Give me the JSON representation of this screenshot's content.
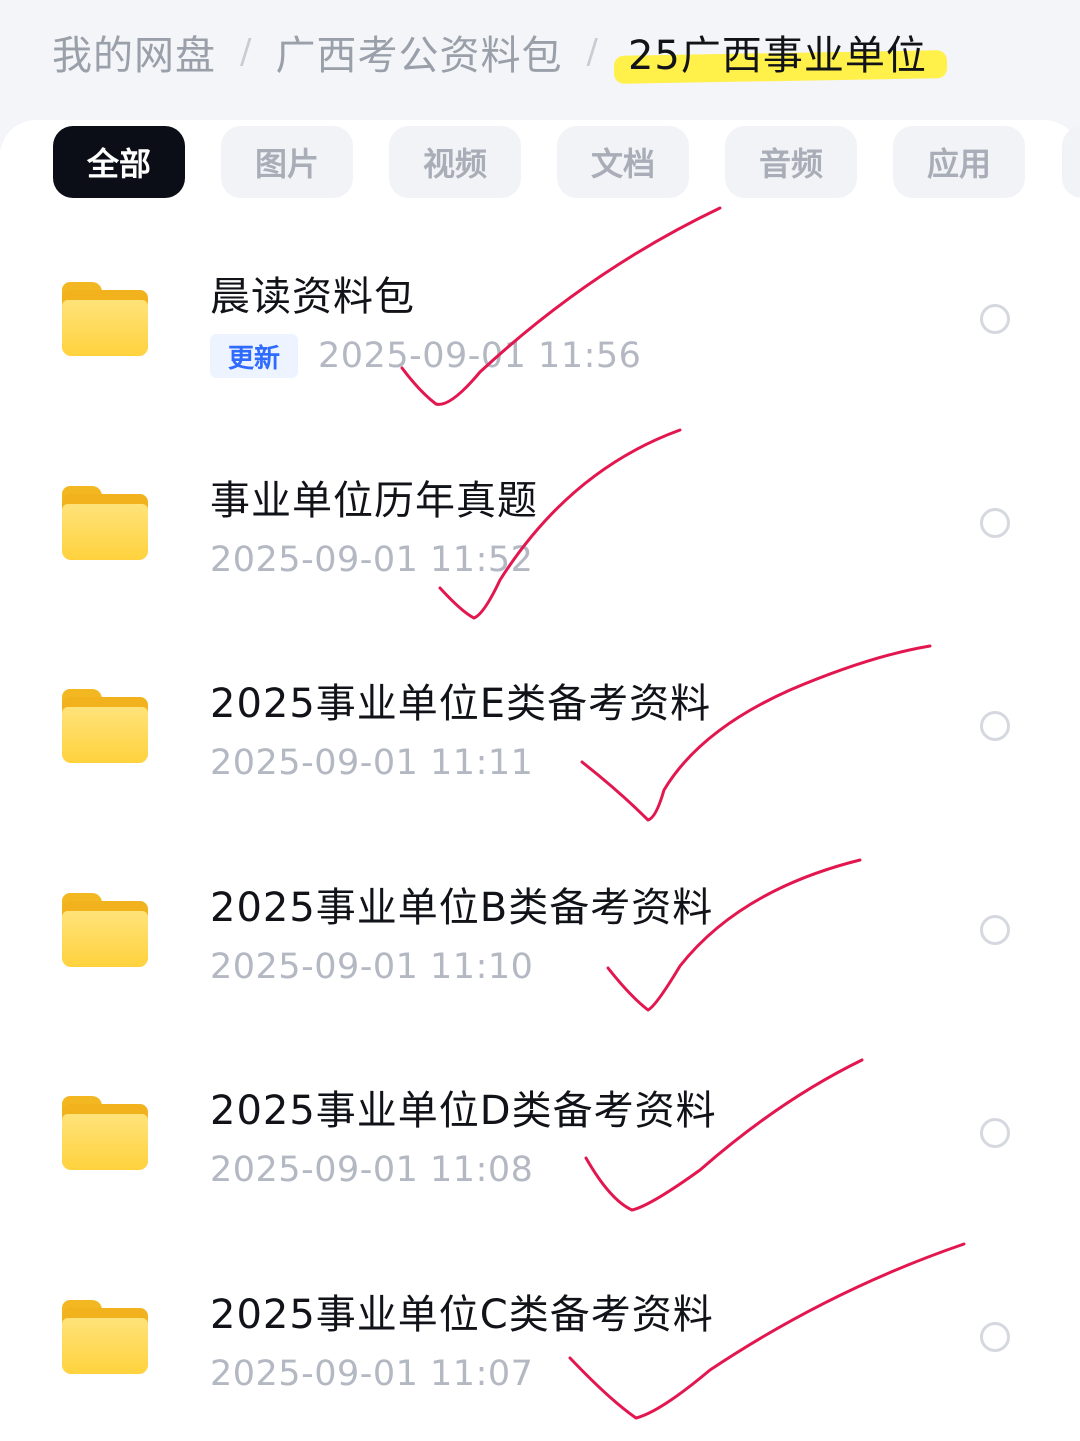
{
  "breadcrumb": {
    "items": [
      "我的网盘",
      "广西考公资料包"
    ],
    "separator": "/",
    "current": "25广西事业单位"
  },
  "tabs": [
    {
      "label": "全部",
      "active": true
    },
    {
      "label": "图片",
      "active": false
    },
    {
      "label": "视频",
      "active": false
    },
    {
      "label": "文档",
      "active": false
    },
    {
      "label": "音频",
      "active": false
    },
    {
      "label": "应用",
      "active": false
    }
  ],
  "files": [
    {
      "name": "晨读资料包",
      "badge": "更新",
      "time": "2025-09-01 11:56",
      "icon": "folder-icon",
      "selected": false
    },
    {
      "name": "事业单位历年真题",
      "time": "2025-09-01 11:52",
      "icon": "folder-icon",
      "selected": false
    },
    {
      "name": "2025事业单位E类备考资料",
      "time": "2025-09-01 11:11",
      "icon": "folder-icon",
      "selected": false
    },
    {
      "name": "2025事业单位B类备考资料",
      "time": "2025-09-01 11:10",
      "icon": "folder-icon",
      "selected": false
    },
    {
      "name": "2025事业单位D类备考资料",
      "time": "2025-09-01 11:08",
      "icon": "folder-icon",
      "selected": false
    },
    {
      "name": "2025事业单位C类备考资料",
      "time": "2025-09-01 11:07",
      "icon": "folder-icon",
      "selected": false
    }
  ],
  "colors": {
    "accent_highlight": "#fff04a",
    "checkmark": "#e3174f",
    "badge_text": "#2f6bff",
    "folder": "#ffd23d"
  }
}
